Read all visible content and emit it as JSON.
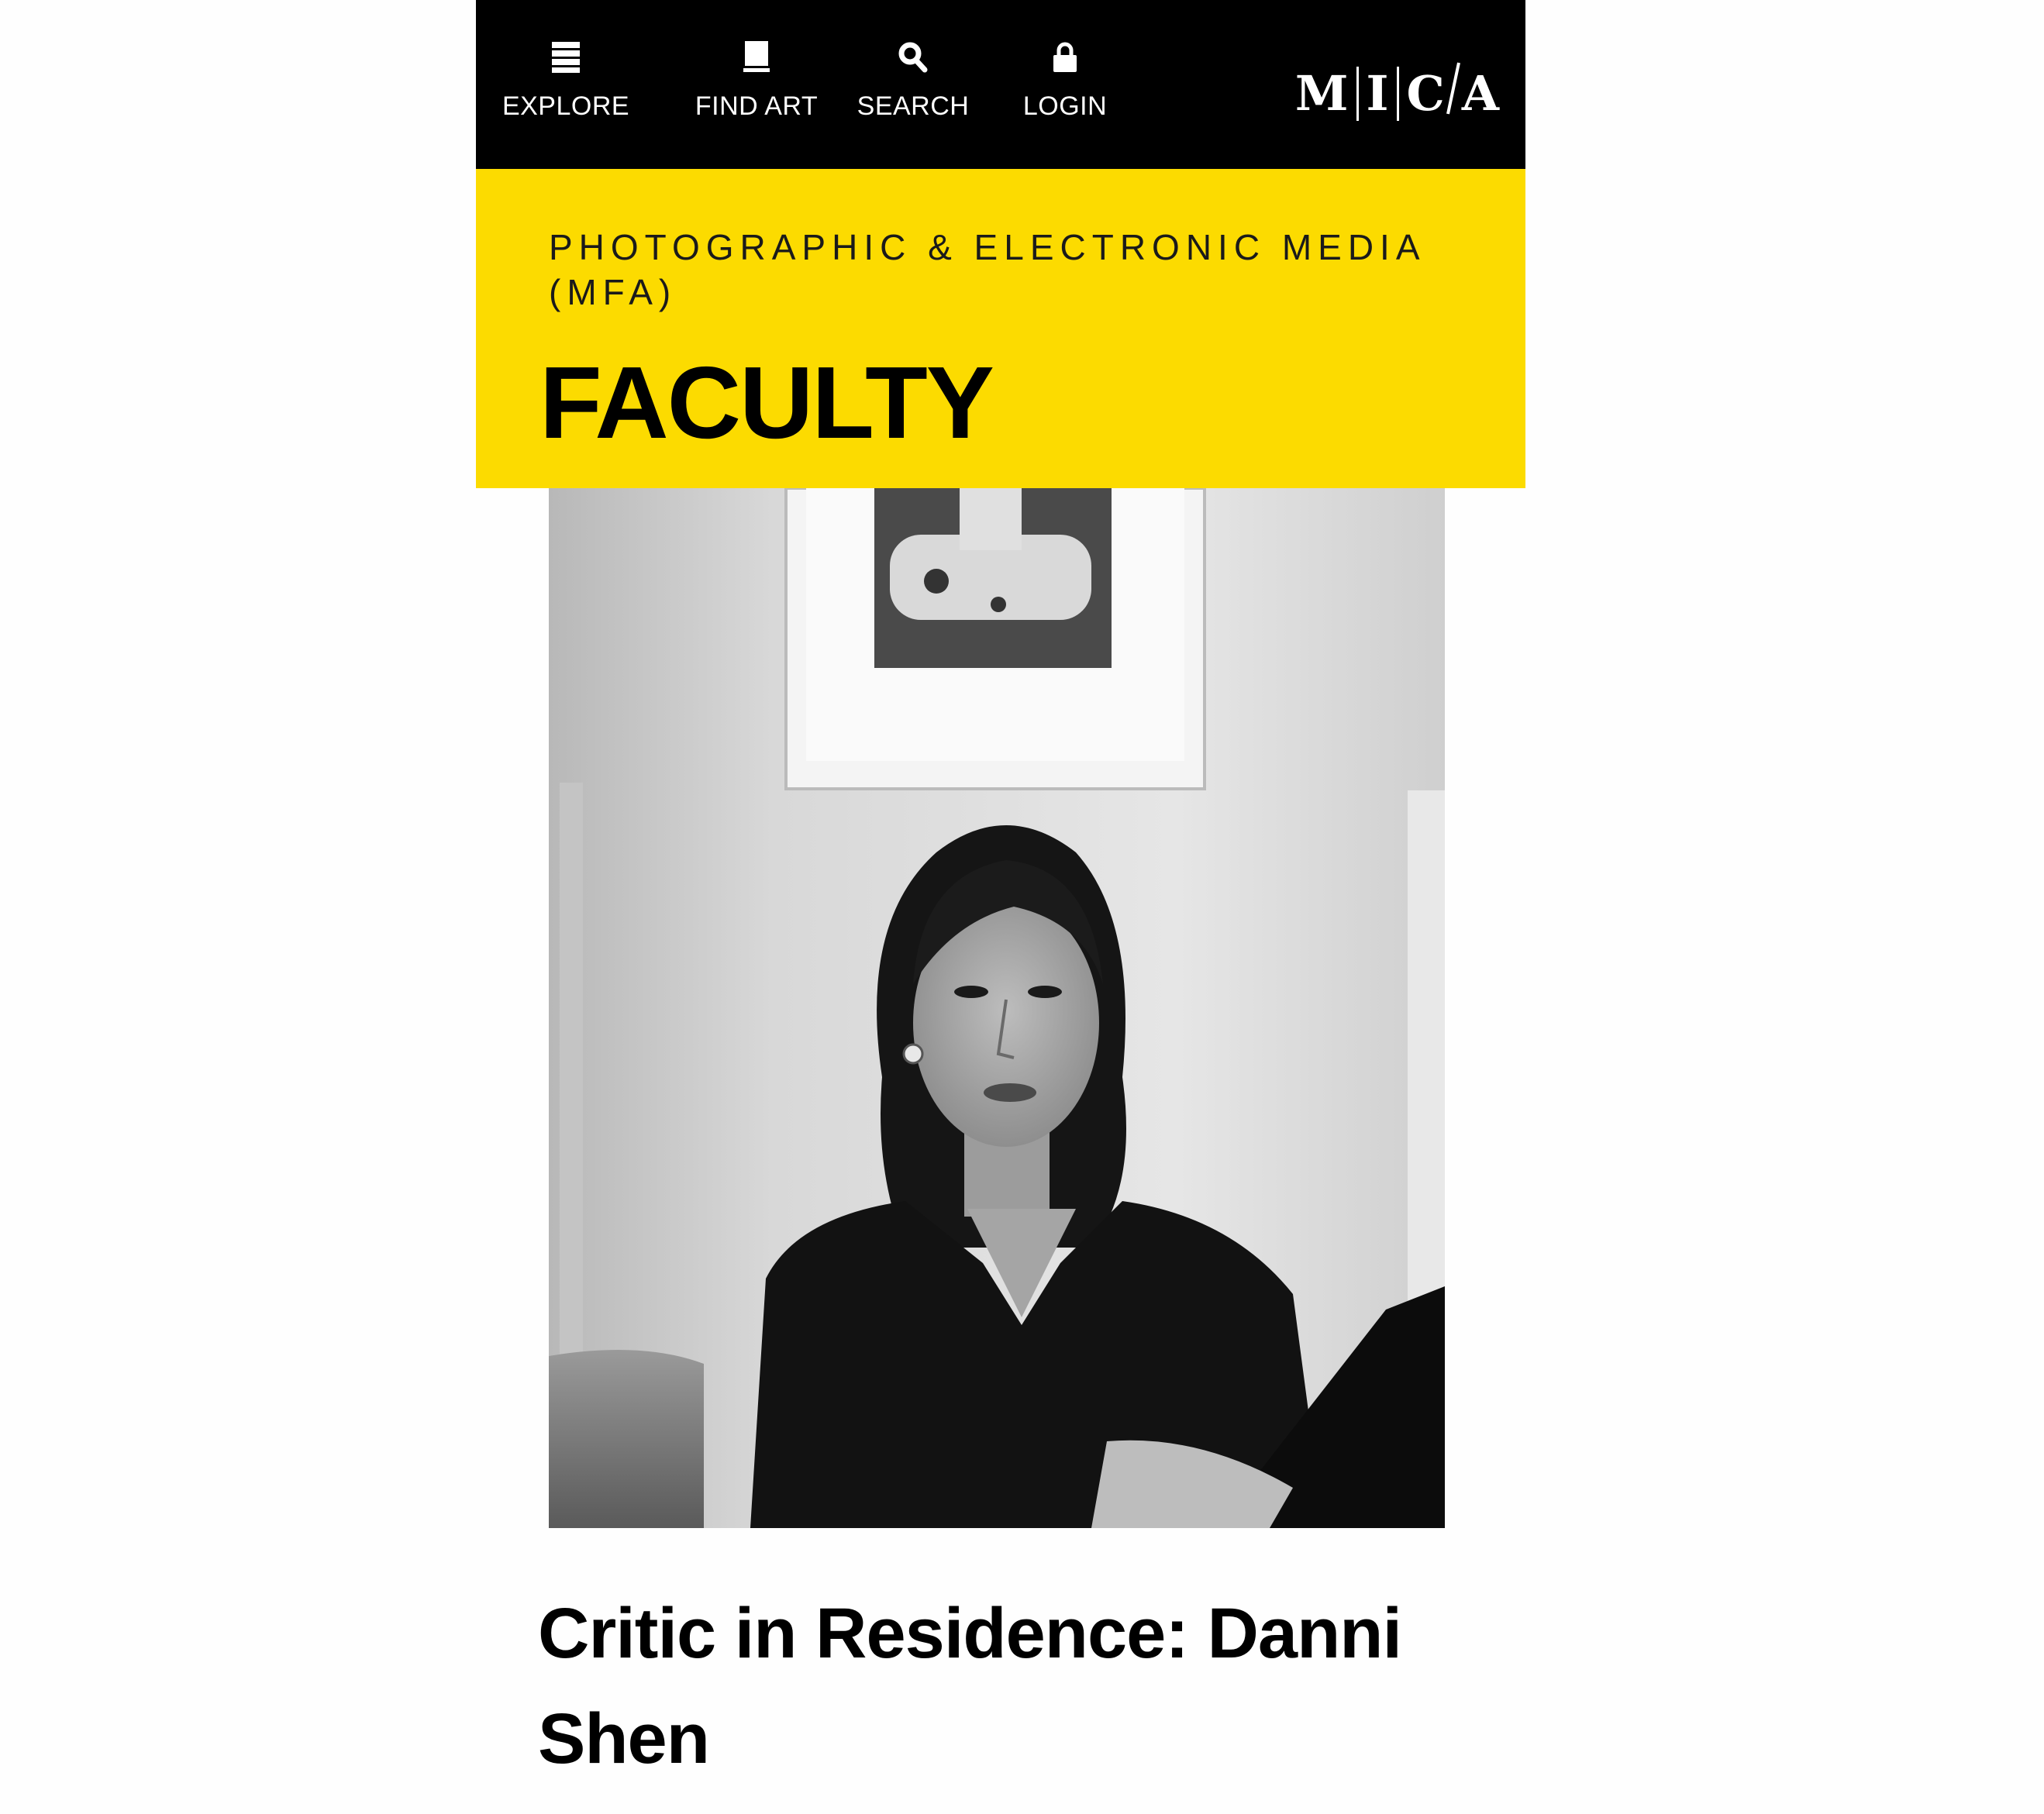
{
  "nav": {
    "explore": {
      "label": "EXPLORE",
      "icon": "menu-icon"
    },
    "find_art": {
      "label": "FIND ART",
      "icon": "book-icon"
    },
    "search": {
      "label": "SEARCH",
      "icon": "search-icon"
    },
    "login": {
      "label": "LOGIN",
      "icon": "lock-icon"
    }
  },
  "logo": {
    "letters": [
      "M",
      "I",
      "C",
      "A"
    ]
  },
  "header": {
    "department": "PHOTOGRAPHIC & ELECTRONIC MEDIA (MFA)",
    "section": "FACULTY"
  },
  "profile": {
    "title": "Critic in Residence: Danni Shen"
  },
  "colors": {
    "nav_background": "#000000",
    "header_background": "#fcdb00",
    "text": "#000000"
  }
}
